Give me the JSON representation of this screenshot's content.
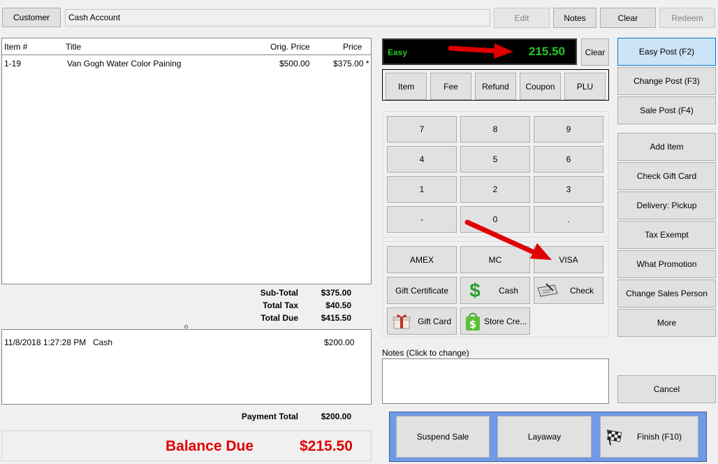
{
  "toolbar": {
    "customer_label": "Customer",
    "customer_value": "Cash Account",
    "edit_label": "Edit",
    "notes_label": "Notes",
    "clear_label": "Clear",
    "redeem_label": "Redeem"
  },
  "items_table": {
    "headers": {
      "item": "Item #",
      "title": "Title",
      "orig_price": "Orig. Price",
      "price": "Price"
    },
    "rows": [
      {
        "item": "1-19",
        "title": "Van Gogh Water Color Paining",
        "orig_price": "$500.00",
        "price": "$375.00 *"
      }
    ]
  },
  "totals": {
    "subtotal_label": "Sub-Total",
    "subtotal_value": "$375.00",
    "tax_label": "Total Tax",
    "tax_value": "$40.50",
    "due_label": "Total Due",
    "due_value": "$415.50"
  },
  "payments": {
    "rows": [
      {
        "datetime": "11/8/2018 1:27:28 PM",
        "method": "Cash",
        "amount": "$200.00"
      }
    ],
    "total_label": "Payment Total",
    "total_value": "$200.00"
  },
  "balance": {
    "label": "Balance Due",
    "value": "$215.50"
  },
  "display": {
    "mode": "Easy",
    "amount": "215.50",
    "clear_label": "Clear"
  },
  "type_buttons": {
    "item": "Item",
    "fee": "Fee",
    "refund": "Refund",
    "coupon": "Coupon",
    "plu": "PLU"
  },
  "keypad": {
    "k7": "7",
    "k8": "8",
    "k9": "9",
    "k4": "4",
    "k5": "5",
    "k6": "6",
    "k1": "1",
    "k2": "2",
    "k3": "3",
    "kminus": "-",
    "k0": "0",
    "kdot": "."
  },
  "tenders": {
    "amex": "AMEX",
    "mc": "MC",
    "visa": "VISA",
    "gift_certificate": "Gift Certificate",
    "cash": "Cash",
    "check": "Check",
    "gift_card": "Gift Card",
    "store_credit": "Store Cre..."
  },
  "notes_area": {
    "label": "Notes (Click to change)"
  },
  "side_buttons": {
    "easy_post": "Easy Post (F2)",
    "change_post": "Change Post (F3)",
    "sale_post": "Sale Post (F4)",
    "add_item": "Add Item",
    "check_gift_card": "Check Gift Card",
    "delivery_pickup": "Delivery: Pickup",
    "tax_exempt": "Tax Exempt",
    "what_promotion": "What Promotion",
    "change_sales_person": "Change Sales Person",
    "more": "More",
    "cancel": "Cancel"
  },
  "bottom_buttons": {
    "suspend": "Suspend Sale",
    "layaway": "Layaway",
    "finish": "Finish (F10)"
  },
  "colors": {
    "balance_red": "#e00000",
    "display_green": "#22cc22",
    "arrow_red": "#e00000",
    "finish_panel_blue": "#6f9be6"
  }
}
